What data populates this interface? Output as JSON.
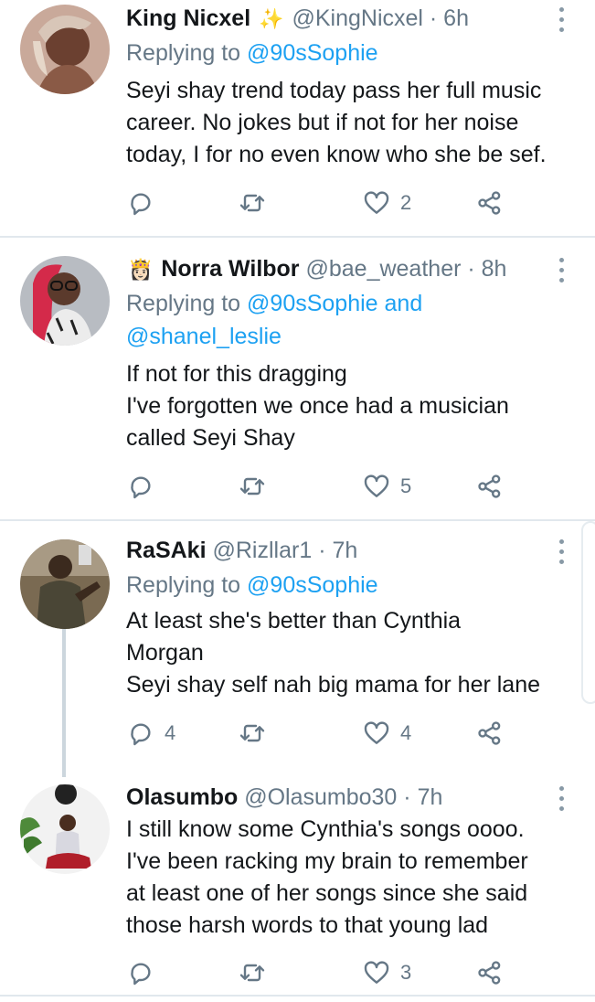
{
  "tweets": [
    {
      "name": "King Nicxel",
      "emoji": "✨",
      "handle": "@KingNicxel",
      "time": "· 6h",
      "reply_prefix": "Replying to",
      "reply_mentions": [
        "@90sSophie"
      ],
      "body_lines": [
        "Seyi shay trend today pass her full music",
        "career. No jokes but if not for her noise",
        "today, I for no even know who she be sef."
      ],
      "counts": {
        "reply": "",
        "retweet": "",
        "like": "2"
      }
    },
    {
      "name": "Norra Wilbor",
      "emoji": "👸🏻",
      "handle": "@bae_weather",
      "time": "· 8h",
      "reply_prefix": "Replying to",
      "reply_mentions": [
        "@90sSophie",
        "and",
        "@shanel_leslie"
      ],
      "body_lines": [
        "If not for this dragging",
        "I've forgotten we once had a musician",
        "called Seyi Shay"
      ],
      "counts": {
        "reply": "",
        "retweet": "",
        "like": "5"
      }
    },
    {
      "name": "RaSAki",
      "emoji": "",
      "handle": "@Rizllar1",
      "time": "· 7h",
      "reply_prefix": "Replying to",
      "reply_mentions": [
        "@90sSophie"
      ],
      "body_lines": [
        "At least she's better than Cynthia",
        "Morgan",
        "Seyi shay self nah big mama for her lane"
      ],
      "counts": {
        "reply": "4",
        "retweet": "",
        "like": "4"
      }
    },
    {
      "name": "Olasumbo",
      "emoji": "",
      "handle": "@Olasumbo30",
      "time": "· 7h",
      "reply_prefix": "",
      "reply_mentions": [],
      "body_lines": [
        "I still know some Cynthia's songs oooo.",
        "I've been racking my brain to remember",
        "at least one of her songs since she said",
        "those harsh words to that young lad"
      ],
      "counts": {
        "reply": "",
        "retweet": "",
        "like": "3"
      }
    }
  ],
  "icons": {
    "reply": "comment-icon",
    "retweet": "retweet-icon",
    "like": "heart-icon",
    "share": "share-icon",
    "more": "more-vertical-icon"
  },
  "colors": {
    "text": "#14171a",
    "secondary": "#657786",
    "link": "#1da1f2",
    "icon": "#657786",
    "divider": "#e1e8ed"
  }
}
